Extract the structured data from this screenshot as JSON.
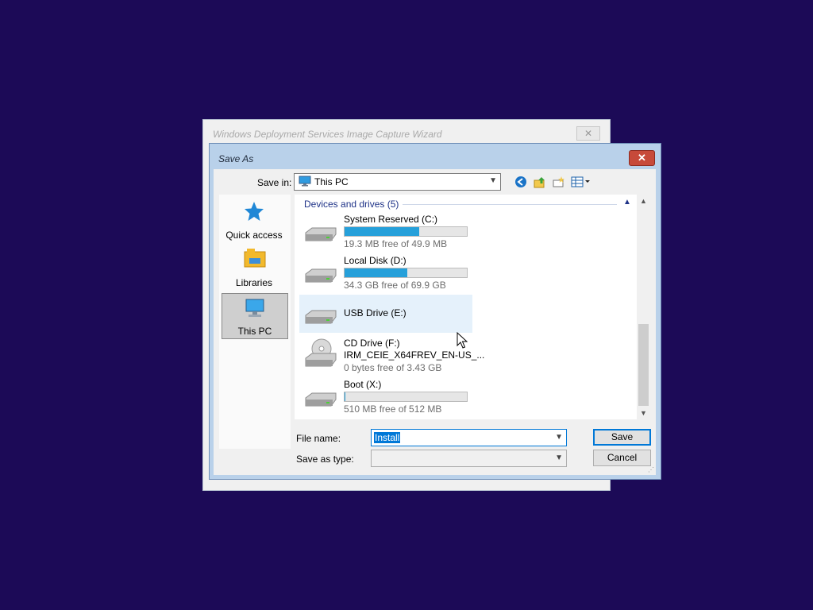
{
  "wizard": {
    "title": "Windows Deployment Services Image Capture Wizard",
    "close_glyph": "✕"
  },
  "dialog": {
    "title": "Save As",
    "close_glyph": "✕"
  },
  "save_in": {
    "label": "Save in:",
    "value": "This PC"
  },
  "toolbar": {
    "icons": [
      "back-icon",
      "up-folder-icon",
      "new-folder-icon",
      "view-menu-icon"
    ]
  },
  "places": [
    {
      "label": "Quick access",
      "icon": "star-icon"
    },
    {
      "label": "Libraries",
      "icon": "libraries-icon"
    },
    {
      "label": "This PC",
      "icon": "this-pc-icon",
      "selected": true
    }
  ],
  "group": {
    "header": "Devices and drives (5)"
  },
  "drives": [
    {
      "name": "System Reserved (C:)",
      "free": "19.3 MB free of 49.9 MB",
      "used_fraction": 0.61
    },
    {
      "name": "Local Disk (D:)",
      "free": "34.3 GB free of 69.9 GB",
      "used_fraction": 0.51
    },
    {
      "name": "USB Drive (E:)"
    },
    {
      "name": "CD Drive (F:)",
      "label": "IRM_CEIE_X64FREV_EN-US_...",
      "free": "0 bytes free of 3.43 GB"
    },
    {
      "name": "Boot (X:)",
      "free": "510 MB free of 512 MB",
      "used_fraction": 0.004
    }
  ],
  "file_name": {
    "label": "File name:",
    "value": "Install"
  },
  "save_as_type": {
    "label": "Save as type:",
    "value": ""
  },
  "buttons": {
    "save": "Save",
    "cancel": "Cancel"
  },
  "colors": {
    "background": "#1c0a57",
    "accent": "#0078d7",
    "bar_fill": "#26a0da"
  }
}
